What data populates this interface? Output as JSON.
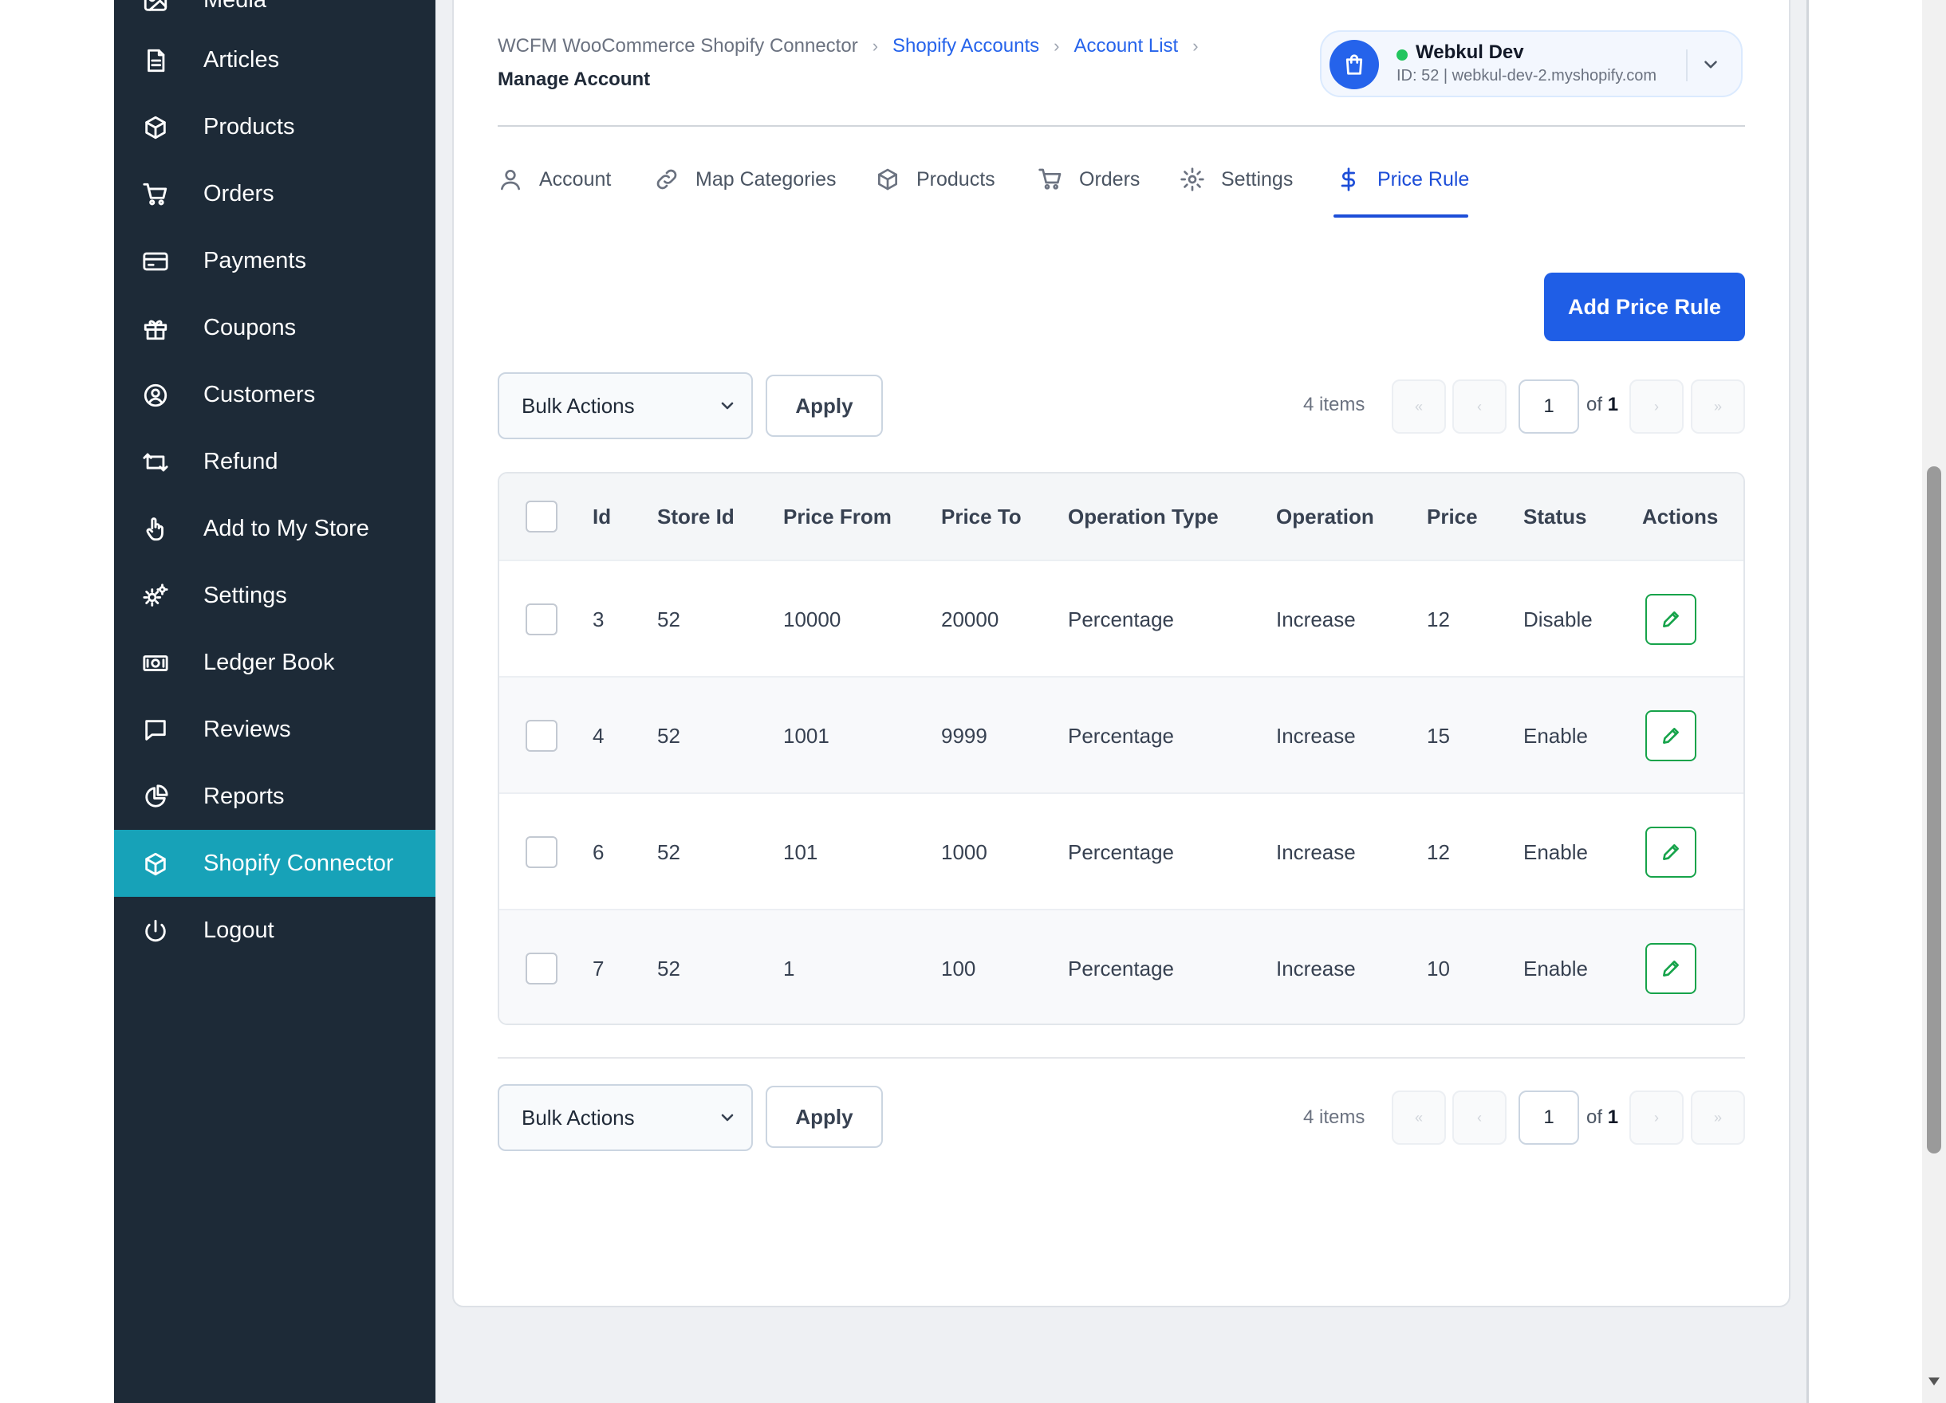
{
  "sidebar": {
    "items": [
      {
        "label": "Media",
        "icon": "image-icon"
      },
      {
        "label": "Articles",
        "icon": "document-icon"
      },
      {
        "label": "Products",
        "icon": "box-icon"
      },
      {
        "label": "Orders",
        "icon": "cart-icon"
      },
      {
        "label": "Payments",
        "icon": "credit-card-icon"
      },
      {
        "label": "Coupons",
        "icon": "gift-icon"
      },
      {
        "label": "Customers",
        "icon": "user-circle-icon"
      },
      {
        "label": "Refund",
        "icon": "refund-arrows-icon"
      },
      {
        "label": "Add to My Store",
        "icon": "hand-pointer-icon"
      },
      {
        "label": "Settings",
        "icon": "gears-icon"
      },
      {
        "label": "Ledger Book",
        "icon": "money-icon"
      },
      {
        "label": "Reviews",
        "icon": "comment-icon"
      },
      {
        "label": "Reports",
        "icon": "pie-chart-icon"
      },
      {
        "label": "Shopify Connector",
        "icon": "box-icon",
        "active": true
      },
      {
        "label": "Logout",
        "icon": "power-icon"
      }
    ]
  },
  "breadcrumb": {
    "root": "WCFM WooCommerce Shopify Connector",
    "accounts": "Shopify Accounts",
    "list": "Account List",
    "current": "Manage Account"
  },
  "account": {
    "name": "Webkul Dev",
    "meta": "ID: 52 | webkul-dev-2.myshopify.com",
    "status_color": "#22c55e"
  },
  "tabs": [
    {
      "label": "Account",
      "icon": "user-icon"
    },
    {
      "label": "Map Categories",
      "icon": "link-icon"
    },
    {
      "label": "Products",
      "icon": "box-icon"
    },
    {
      "label": "Orders",
      "icon": "cart-icon"
    },
    {
      "label": "Settings",
      "icon": "gear-icon"
    },
    {
      "label": "Price Rule",
      "icon": "dollar-icon",
      "active": true
    }
  ],
  "add_button": "Add Price Rule",
  "toolbar": {
    "bulk_label": "Bulk Actions",
    "apply_label": "Apply",
    "items_count": "4 items",
    "first": "«",
    "prev": "‹",
    "next": "›",
    "last": "»",
    "page": "1",
    "of_label": "of",
    "total_pages": "1"
  },
  "table": {
    "headers": [
      "Id",
      "Store Id",
      "Price From",
      "Price To",
      "Operation Type",
      "Operation",
      "Price",
      "Status",
      "Actions"
    ],
    "rows": [
      {
        "id": "3",
        "store_id": "52",
        "price_from": "10000",
        "price_to": "20000",
        "operation_type": "Percentage",
        "operation": "Increase",
        "price": "12",
        "status": "Disable"
      },
      {
        "id": "4",
        "store_id": "52",
        "price_from": "1001",
        "price_to": "9999",
        "operation_type": "Percentage",
        "operation": "Increase",
        "price": "15",
        "status": "Enable"
      },
      {
        "id": "6",
        "store_id": "52",
        "price_from": "101",
        "price_to": "1000",
        "operation_type": "Percentage",
        "operation": "Increase",
        "price": "12",
        "status": "Enable"
      },
      {
        "id": "7",
        "store_id": "52",
        "price_from": "1",
        "price_to": "100",
        "operation_type": "Percentage",
        "operation": "Increase",
        "price": "10",
        "status": "Enable"
      }
    ]
  },
  "colors": {
    "sidebar_bg": "#1d2a37",
    "active_nav": "#17a2b8",
    "primary": "#1f5ee6",
    "edit_green": "#16a34a"
  }
}
